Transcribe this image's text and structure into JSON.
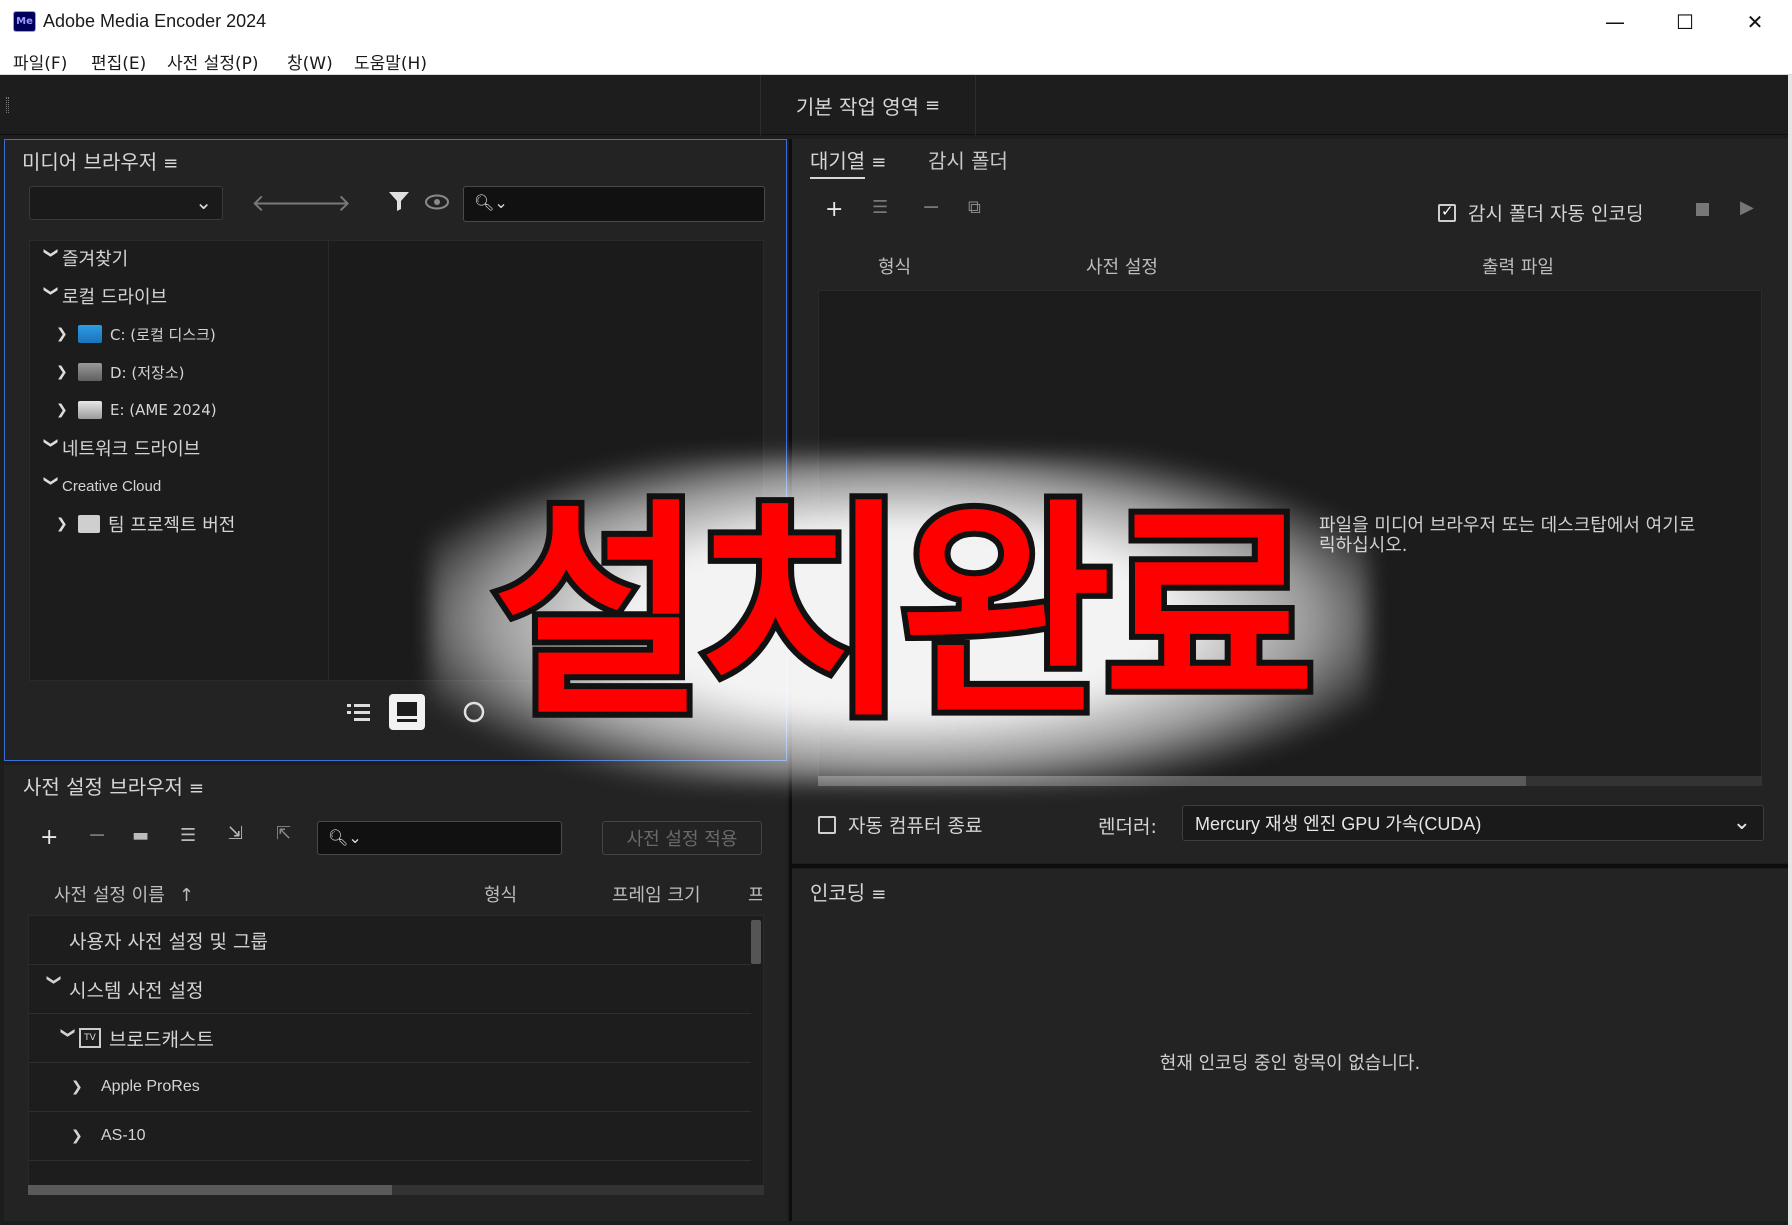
{
  "window": {
    "title": "Adobe Media Encoder 2024",
    "logo_text": "Me",
    "minimize": "—",
    "maximize": "☐",
    "close": "✕"
  },
  "menu": [
    "파일(F)",
    "편집(E)",
    "사전 설정(P)",
    "창(W)",
    "도움말(H)"
  ],
  "workspace": {
    "tab": "기본 작업 영역"
  },
  "media_browser": {
    "title": "미디어 브라우저",
    "tree": {
      "favorites": "즐겨찾기",
      "local_drives": "로컬 드라이브",
      "drive_c": "C: (로컬 디스크)",
      "drive_d": "D: (저장소)",
      "drive_e": "E: (AME 2024)",
      "network_drives": "네트워크 드라이브",
      "creative_cloud": "Creative Cloud",
      "team_project": "팀 프로젝트 버전"
    }
  },
  "preset_browser": {
    "title": "사전 설정 브라우저",
    "apply_button": "사전 설정 적용",
    "columns": {
      "name": "사전 설정 이름",
      "format": "형식",
      "frame_size": "프레임 크기",
      "more": "프"
    },
    "rows": {
      "user": "사용자 사전 설정 및 그룹",
      "system": "시스템 사전 설정",
      "broadcast": "브로드캐스트",
      "prores": "Apple ProRes",
      "as10": "AS-10"
    }
  },
  "queue": {
    "tab_queue": "대기열",
    "tab_watch": "감시 폴더",
    "auto_encode_label": "감시 폴더 자동 인코딩",
    "auto_encode_checked": true,
    "columns": {
      "format": "형식",
      "preset": "사전 설정",
      "output": "출력 파일"
    },
    "hint_line1": "파일을 미디어 브라우저 또는 데스크탑에서 여기로",
    "hint_line2": "릭하십시오.",
    "auto_shutdown_label": "자동 컴퓨터 종료",
    "auto_shutdown_checked": false,
    "renderer_label": "렌더러:",
    "renderer_value": "Mercury 재생 엔진 GPU 가속(CUDA)"
  },
  "encoding": {
    "title": "인코딩",
    "empty_message": "현재 인코딩 중인 항목이 없습니다."
  },
  "overlay": {
    "text": "설치완료",
    "color": "#ff0000"
  }
}
